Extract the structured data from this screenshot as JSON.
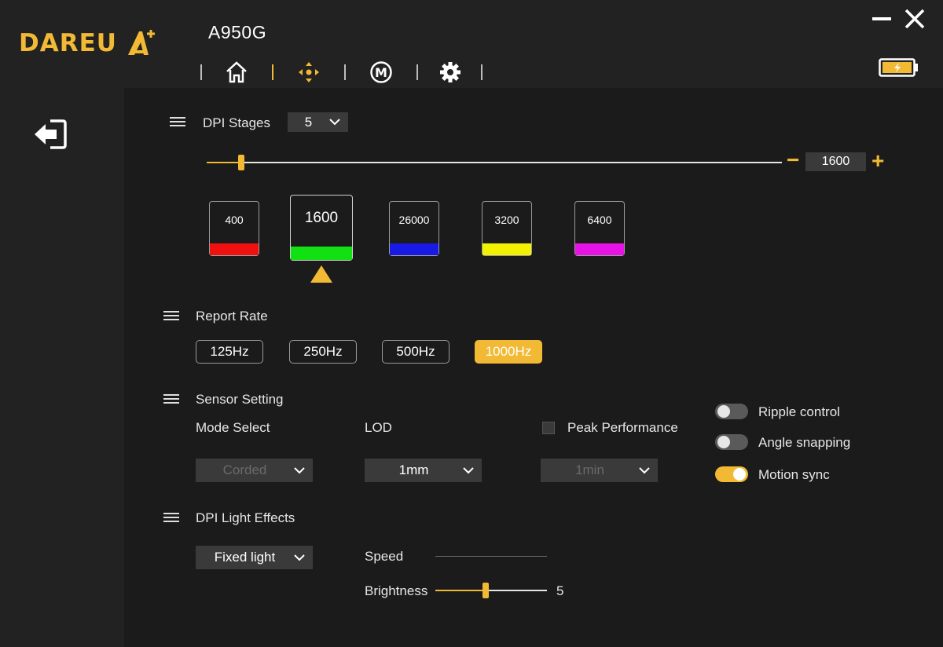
{
  "app": {
    "brand": "DAREU",
    "device": "A950G"
  },
  "nav": {
    "items": [
      {
        "name": "home",
        "icon": "home-icon",
        "active": false
      },
      {
        "name": "dpi",
        "icon": "dpi-move-icon",
        "active": true
      },
      {
        "name": "macro",
        "icon": "macro-m-icon",
        "active": false
      },
      {
        "name": "settings",
        "icon": "gear-icon",
        "active": false
      }
    ]
  },
  "dpi": {
    "section_label": "DPI Stages",
    "stages_count": "5",
    "current_value": "1600",
    "minus_label": "−",
    "plus_label": "+",
    "slider_fraction": 0.06,
    "stages": [
      {
        "value": "400",
        "color": "#f01010",
        "selected": false
      },
      {
        "value": "1600",
        "color": "#12e012",
        "selected": true
      },
      {
        "value": "26000",
        "color": "#1a1ae6",
        "selected": false
      },
      {
        "value": "3200",
        "color": "#f2f200",
        "selected": false
      },
      {
        "value": "6400",
        "color": "#e612e6",
        "selected": false
      }
    ]
  },
  "report_rate": {
    "section_label": "Report Rate",
    "options": [
      "125Hz",
      "250Hz",
      "500Hz",
      "1000Hz"
    ],
    "selected": "1000Hz"
  },
  "sensor": {
    "section_label": "Sensor Setting",
    "mode_label": "Mode Select",
    "mode_value": "Corded",
    "lod_label": "LOD",
    "lod_value": "1mm",
    "peak_label": "Peak Performance",
    "peak_checked": false,
    "peak_value": "1min",
    "toggles": [
      {
        "label": "Ripple control",
        "on": false
      },
      {
        "label": "Angle snapping",
        "on": false
      },
      {
        "label": "Motion sync",
        "on": true
      }
    ]
  },
  "light": {
    "section_label": "DPI Light Effects",
    "effect_value": "Fixed light",
    "speed_label": "Speed",
    "brightness_label": "Brightness",
    "brightness_value": "5",
    "brightness_fraction": 0.45
  },
  "colors": {
    "accent": "#f2ba34",
    "panel": "#222222",
    "background": "#1b1b1b"
  }
}
